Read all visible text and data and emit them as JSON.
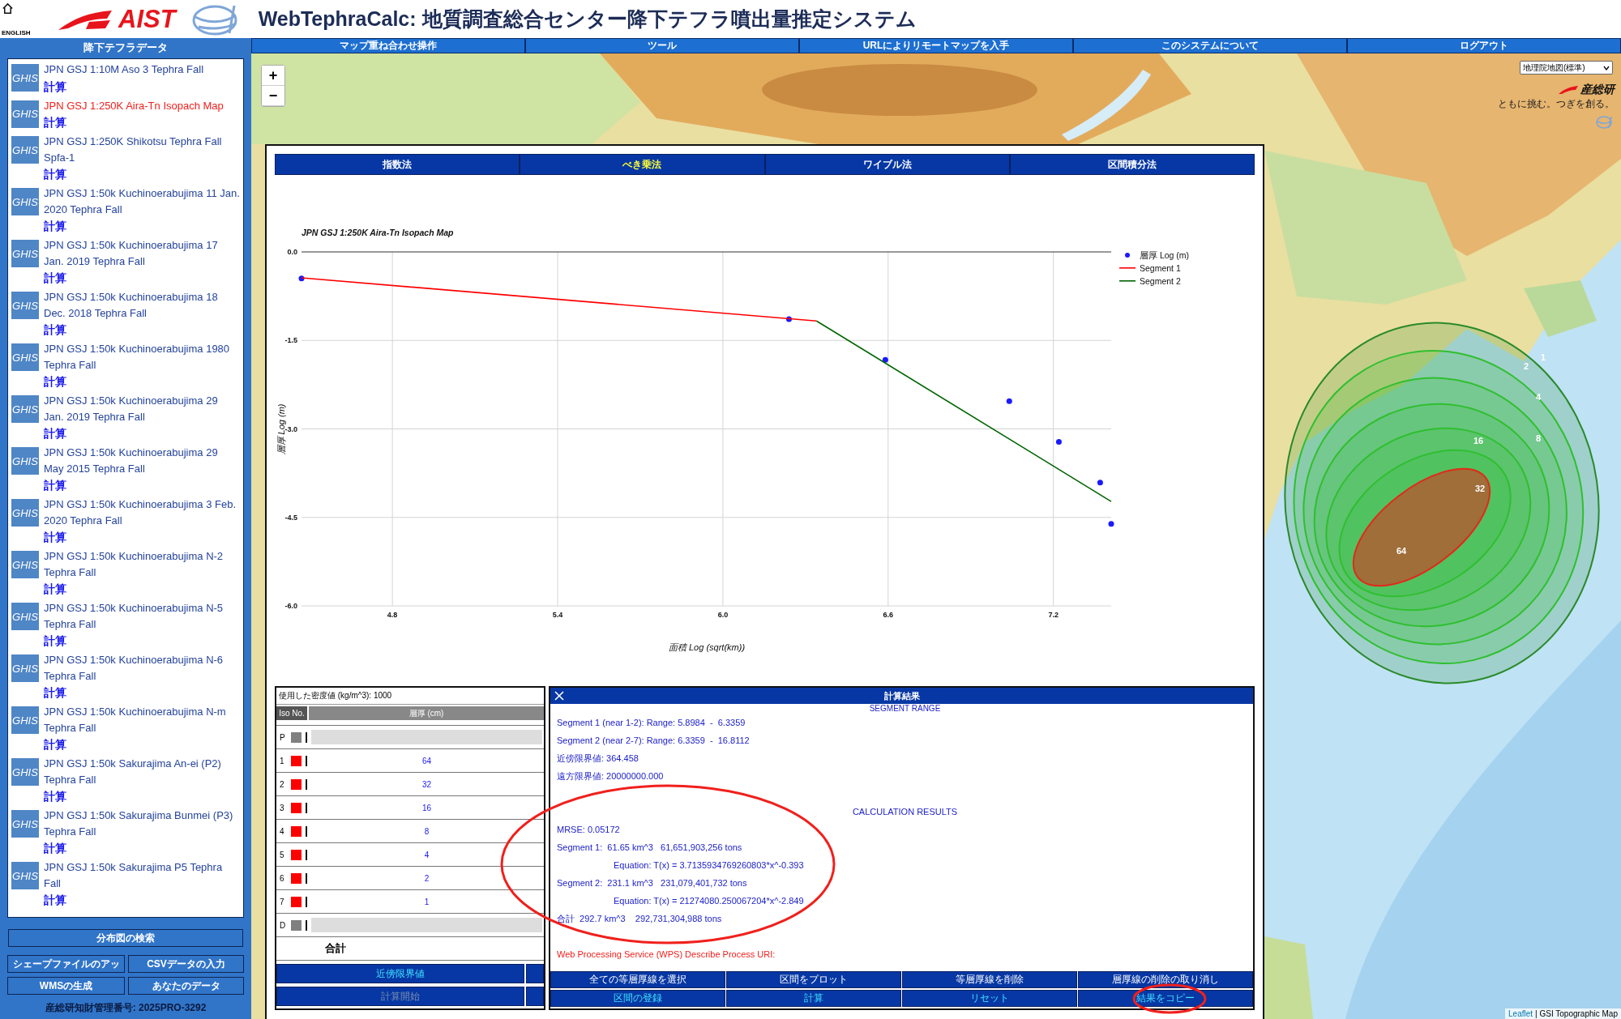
{
  "header": {
    "language_link": "ENGLISH",
    "logo_text": "AIST",
    "title": "WebTephraCalc: 地質調査総合センター降下テフラ噴出量推定システム"
  },
  "sidebar": {
    "title": "降下テフラデータ",
    "datasets": [
      {
        "badge": "GHIS",
        "name": "JPN GSJ 1:10M Aso 3 Tephra Fall",
        "action": "計算",
        "selected": false
      },
      {
        "badge": "GHIS",
        "name": "JPN GSJ 1:250K Aira-Tn Isopach Map",
        "action": "計算",
        "selected": true
      },
      {
        "badge": "GHIS",
        "name": "JPN GSJ 1:250K Shikotsu Tephra Fall Spfa-1",
        "action": "計算",
        "selected": false
      },
      {
        "badge": "GHIS",
        "name": "JPN GSJ 1:50k Kuchinoerabujima 11 Jan. 2020 Tephra Fall",
        "action": "計算",
        "selected": false
      },
      {
        "badge": "GHIS",
        "name": "JPN GSJ 1:50k Kuchinoerabujima 17 Jan. 2019 Tephra Fall",
        "action": "計算",
        "selected": false
      },
      {
        "badge": "GHIS",
        "name": "JPN GSJ 1:50k Kuchinoerabujima 18 Dec. 2018 Tephra Fall",
        "action": "計算",
        "selected": false
      },
      {
        "badge": "GHIS",
        "name": "JPN GSJ 1:50k Kuchinoerabujima 1980 Tephra Fall",
        "action": "計算",
        "selected": false
      },
      {
        "badge": "GHIS",
        "name": "JPN GSJ 1:50k Kuchinoerabujima 29 Jan. 2019 Tephra Fall",
        "action": "計算",
        "selected": false
      },
      {
        "badge": "GHIS",
        "name": "JPN GSJ 1:50k Kuchinoerabujima 29 May 2015 Tephra Fall",
        "action": "計算",
        "selected": false
      },
      {
        "badge": "GHIS",
        "name": "JPN GSJ 1:50k Kuchinoerabujima 3 Feb. 2020 Tephra Fall",
        "action": "計算",
        "selected": false
      },
      {
        "badge": "GHIS",
        "name": "JPN GSJ 1:50k Kuchinoerabujima N-2 Tephra Fall",
        "action": "計算",
        "selected": false
      },
      {
        "badge": "GHIS",
        "name": "JPN GSJ 1:50k Kuchinoerabujima N-5 Tephra Fall",
        "action": "計算",
        "selected": false
      },
      {
        "badge": "GHIS",
        "name": "JPN GSJ 1:50k Kuchinoerabujima N-6 Tephra Fall",
        "action": "計算",
        "selected": false
      },
      {
        "badge": "GHIS",
        "name": "JPN GSJ 1:50k Kuchinoerabujima N-m Tephra Fall",
        "action": "計算",
        "selected": false
      },
      {
        "badge": "GHIS",
        "name": "JPN GSJ 1:50k Sakurajima An-ei (P2) Tephra Fall",
        "action": "計算",
        "selected": false
      },
      {
        "badge": "GHIS",
        "name": "JPN GSJ 1:50k Sakurajima Bunmei (P3) Tephra Fall",
        "action": "計算",
        "selected": false
      },
      {
        "badge": "GHIS",
        "name": "JPN GSJ 1:50k Sakurajima P5 Tephra Fall",
        "action": "計算",
        "selected": false
      }
    ],
    "search_button": "分布図の検索",
    "buttons": [
      "シェープファイルのアッ",
      "CSVデータの入力",
      "WMSの生成",
      "あなたのデータ"
    ],
    "footer": "産総研知財管理番号: 2025PRO-3292"
  },
  "nav": [
    "マップ重ね合わせ操作",
    "ツール",
    "URLによりリモートマップを入手",
    "このシステムについて",
    "ログアウト"
  ],
  "map": {
    "zoom_in": "+",
    "zoom_out": "−",
    "layer_select": "地理院地図(標準)",
    "logo_text": "産総研",
    "logo_tagline": "ともに挑む。つぎを創る。",
    "isopachs": [
      {
        "label": "64",
        "kind": "inner"
      },
      {
        "label": "32",
        "kind": "middle"
      },
      {
        "label": "16",
        "kind": "middle"
      },
      {
        "label": "8",
        "kind": "middle"
      },
      {
        "label": "4",
        "kind": "middle"
      },
      {
        "label": "2",
        "kind": "middle"
      },
      {
        "label": "1",
        "kind": "outer"
      }
    ],
    "attribution_link": "Leaflet",
    "attribution_text": "| GSI Topographic Map"
  },
  "chart": {
    "tabs": [
      {
        "label": "指数法",
        "selected": false
      },
      {
        "label": "べき乗法",
        "selected": true
      },
      {
        "label": "ワイブル法",
        "selected": false
      },
      {
        "label": "区間積分法",
        "selected": false
      }
    ],
    "chart_data": {
      "type": "scatter",
      "grid": true,
      "legend": "right",
      "title": "JPN GSJ 1:250K Aira-Tn Isopach Map",
      "xlabel": "面積 Log (sqrt(km))",
      "ylabel": "層厚 Log (m)",
      "xlim": [
        4.47,
        7.41
      ],
      "ylim": [
        -6,
        0
      ],
      "xticks": [
        {
          "value": 4.8,
          "label": "4.8"
        },
        {
          "value": 5.4,
          "label": "5.4"
        },
        {
          "value": 6,
          "label": "6.0"
        },
        {
          "value": 6.6,
          "label": "6.6"
        },
        {
          "value": 7.2,
          "label": "7.2"
        }
      ],
      "yticks": [
        {
          "value": 0,
          "label": "0.0"
        },
        {
          "value": -1.5,
          "label": "-1.5"
        },
        {
          "value": -3,
          "label": "-3.0"
        },
        {
          "value": -4.5,
          "label": "-4.5"
        },
        {
          "value": -6,
          "label": "-6.0"
        }
      ],
      "series": [
        {
          "name": "層厚 Log (m)",
          "color": "#1a1aff",
          "x": [
            4.47,
            6.24,
            6.59,
            7.04,
            7.22,
            7.37,
            7.41
          ],
          "values": [
            -0.45,
            -1.14,
            -1.83,
            -2.53,
            -3.22,
            -3.91,
            -4.61
          ]
        },
        {
          "name": "Segment 1",
          "type": "line",
          "color": "#ff0000",
          "x": [
            4.47,
            6.34
          ],
          "values": [
            -0.44,
            -1.17
          ]
        },
        {
          "name": "Segment 2",
          "type": "line",
          "color": "#006400",
          "x": [
            6.34,
            7.41
          ],
          "values": [
            -1.17,
            -4.23
          ]
        }
      ]
    }
  },
  "thickness_table": {
    "density_label": "使用した密度値 (kg/m^3): 1000",
    "columns": [
      "Iso No.",
      "層厚 (cm)"
    ],
    "rows": [
      {
        "iso": "P",
        "kind": "boundary",
        "color": "#808080"
      },
      {
        "iso": "1",
        "kind": "contour",
        "color": "#ff0000",
        "value": "64"
      },
      {
        "iso": "2",
        "kind": "contour",
        "color": "#ff0000",
        "value": "32"
      },
      {
        "iso": "3",
        "kind": "contour",
        "color": "#ff0000",
        "value": "16"
      },
      {
        "iso": "4",
        "kind": "contour",
        "color": "#ff0000",
        "value": "8"
      },
      {
        "iso": "5",
        "kind": "contour",
        "color": "#ff0000",
        "value": "4"
      },
      {
        "iso": "6",
        "kind": "contour",
        "color": "#ff0000",
        "value": "2"
      },
      {
        "iso": "7",
        "kind": "contour",
        "color": "#ff0000",
        "value": "1"
      },
      {
        "iso": "D",
        "kind": "boundary",
        "color": "#808080"
      }
    ],
    "total_label": "合計",
    "buttons": [
      {
        "label": "近傍限界値",
        "disabled": false
      },
      {
        "label": "計算開始",
        "disabled": true
      }
    ]
  },
  "results_dialog": {
    "title": "計算結果",
    "lines": [
      {
        "kind": "caption",
        "text": "SEGMENT RANGE"
      },
      {
        "kind": "plain",
        "text": "Segment 1 (near 1-2): Range: 5.8984  -  6.3359"
      },
      {
        "kind": "plain",
        "text": "Segment 2 (near 2-7): Range: 6.3359  -  16.8112"
      },
      {
        "kind": "plain",
        "text": "近傍限界値: 364.458"
      },
      {
        "kind": "plain",
        "text": "遠方限界値: 20000000.000"
      },
      {
        "kind": "heading",
        "text": "CALCULATION RESULTS"
      },
      {
        "kind": "plain",
        "text": "MRSE: 0.05172"
      },
      {
        "kind": "plain",
        "text": "Segment 1:  61.65 km^3   61,651,903,256 tons"
      },
      {
        "kind": "indented",
        "text": "Equation: T(x) = 3.7135934769260803*x^-0.393"
      },
      {
        "kind": "plain",
        "text": "Segment 2:  231.1 km^3   231,079,401,732 tons"
      },
      {
        "kind": "indented",
        "text": "Equation: T(x) = 21274080.250067204*x^-2.849"
      },
      {
        "kind": "plain",
        "text": "合計  292.7 km^3    292,731,304,988 tons"
      },
      {
        "kind": "warning",
        "text": "Web Processing Service (WPS) Describe Process URI:"
      }
    ],
    "button_rows": [
      [
        "全ての等層厚線を選択",
        "区間をプロット",
        "等層厚線を削除",
        "層厚線の削除の取り消し"
      ],
      [
        "区間の登録",
        "計算",
        "リセット",
        "結果をコピー"
      ]
    ]
  }
}
